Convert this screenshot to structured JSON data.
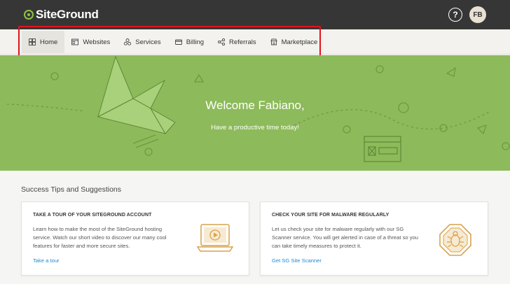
{
  "header": {
    "logo_text": "SiteGround",
    "help_symbol": "?",
    "avatar_initials": "FB"
  },
  "nav": {
    "items": [
      {
        "label": "Home",
        "icon": "home-grid-icon",
        "active": true
      },
      {
        "label": "Websites",
        "icon": "websites-icon"
      },
      {
        "label": "Services",
        "icon": "services-icon"
      },
      {
        "label": "Billing",
        "icon": "billing-card-icon"
      },
      {
        "label": "Referrals",
        "icon": "referrals-icon"
      },
      {
        "label": "Marketplace",
        "icon": "marketplace-icon"
      }
    ]
  },
  "hero": {
    "title": "Welcome Fabiano,",
    "subtitle": "Have a productive time today!"
  },
  "section": {
    "title": "Success Tips and Suggestions"
  },
  "cards": [
    {
      "title": "TAKE A TOUR OF YOUR SITEGROUND ACCOUNT",
      "body": "Learn how to make the most of the SiteGround hosting service. Watch our short video to discover our many cool features for faster and more secure sites.",
      "link": "Take a tour",
      "icon": "laptop-video-icon"
    },
    {
      "title": "CHECK YOUR SITE FOR MALWARE REGULARLY",
      "body": "Let us check your site for malware regularly with our SG Scanner service. You will get alerted in case of a threat so you can take timely measures to protect it.",
      "link": "Get SG Site Scanner",
      "icon": "malware-bug-icon"
    }
  ],
  "colors": {
    "topbar": "#363636",
    "hero_green": "#8dba5a",
    "accent_green": "#8cc63f",
    "link_blue": "#1f8ad1",
    "highlight_red": "#e0141e",
    "illustration_orange": "#d9a24b"
  }
}
